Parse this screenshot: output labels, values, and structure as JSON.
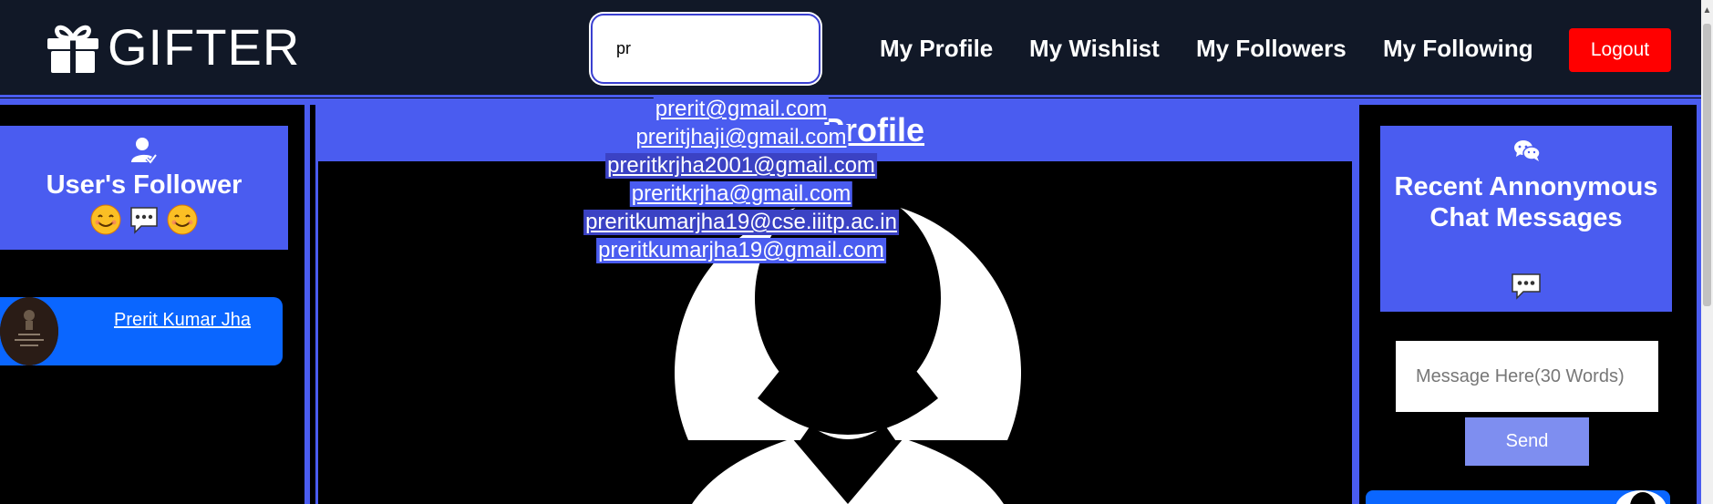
{
  "navbar": {
    "brand": "GIFTER",
    "search_value": "pr",
    "links": [
      "My Profile",
      "My Wishlist",
      "My Followers",
      "My Following"
    ],
    "logout_label": "Logout"
  },
  "search_suggestions": [
    "prerit@gmail.com",
    "preritjhaji@gmail.com",
    "preritkrjha2001@gmail.com",
    "preritkrjha@gmail.com",
    "preritkumarjha19@cse.iiitp.ac.in",
    "preritkumarjha19@gmail.com"
  ],
  "left_panel": {
    "title": "User's Follower",
    "followers": [
      {
        "name": "Prerit Kumar Jha"
      }
    ]
  },
  "center": {
    "title": "Profile"
  },
  "right_panel": {
    "title": "Recent Annonymous Chat Messages",
    "message_placeholder": "Message Here(30 Words)",
    "send_label": "Send"
  },
  "colors": {
    "navbar_bg": "#111827",
    "accent": "#4a5cf0",
    "logout": "#ff0000",
    "list_item": "#0a66ff"
  }
}
